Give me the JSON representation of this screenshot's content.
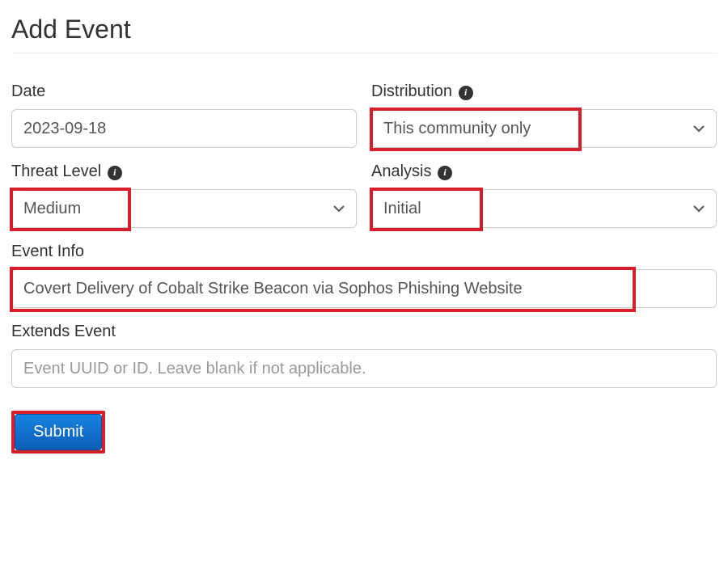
{
  "title": "Add Event",
  "labels": {
    "date": "Date",
    "distribution": "Distribution",
    "threat_level": "Threat Level",
    "analysis": "Analysis",
    "event_info": "Event Info",
    "extends_event": "Extends Event"
  },
  "values": {
    "date": "2023-09-18",
    "distribution": "This community only",
    "threat_level": "Medium",
    "analysis": "Initial",
    "event_info": "Covert Delivery of Cobalt Strike Beacon via Sophos Phishing Website",
    "extends_event": ""
  },
  "placeholders": {
    "extends_event": "Event UUID or ID. Leave blank if not applicable."
  },
  "buttons": {
    "submit": "Submit"
  },
  "colors": {
    "highlight": "#d81e2a",
    "submit_bg_top": "#1783e2",
    "submit_bg_bottom": "#0d5db7"
  }
}
